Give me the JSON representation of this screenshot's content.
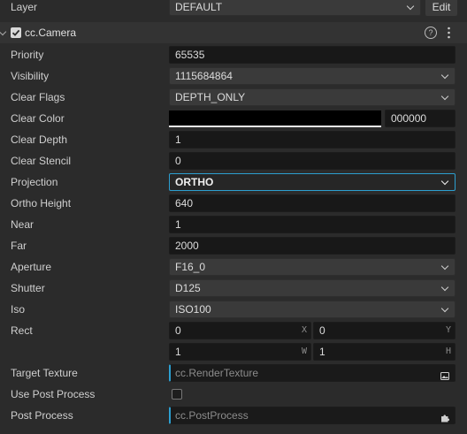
{
  "layer": {
    "label": "Layer",
    "value": "DEFAULT",
    "edit_label": "Edit"
  },
  "component": {
    "name": "cc.Camera",
    "enabled": true
  },
  "props": {
    "priority": {
      "label": "Priority",
      "value": "65535"
    },
    "visibility": {
      "label": "Visibility",
      "value": "1115684864"
    },
    "clear_flags": {
      "label": "Clear Flags",
      "value": "DEPTH_ONLY"
    },
    "clear_color": {
      "label": "Clear Color",
      "hex": "000000",
      "swatch": "#000000"
    },
    "clear_depth": {
      "label": "Clear Depth",
      "value": "1"
    },
    "clear_stencil": {
      "label": "Clear Stencil",
      "value": "0"
    },
    "projection": {
      "label": "Projection",
      "value": "ORTHO"
    },
    "ortho_height": {
      "label": "Ortho Height",
      "value": "640"
    },
    "near": {
      "label": "Near",
      "value": "1"
    },
    "far": {
      "label": "Far",
      "value": "2000"
    },
    "aperture": {
      "label": "Aperture",
      "value": "F16_0"
    },
    "shutter": {
      "label": "Shutter",
      "value": "D125"
    },
    "iso": {
      "label": "Iso",
      "value": "ISO100"
    },
    "rect": {
      "label": "Rect",
      "x": "0",
      "y": "0",
      "w": "1",
      "h": "1",
      "x_suffix": "X",
      "y_suffix": "Y",
      "w_suffix": "W",
      "h_suffix": "H"
    },
    "target_texture": {
      "label": "Target Texture",
      "placeholder": "cc.RenderTexture"
    },
    "use_post_process": {
      "label": "Use Post Process",
      "checked": false
    },
    "post_process": {
      "label": "Post Process",
      "placeholder": "cc.PostProcess"
    }
  },
  "colors": {
    "accent": "#2c9fd0",
    "background": "#2b2b2b"
  },
  "icons": {
    "help": "help-icon",
    "more": "more-icon",
    "texture": "image-icon",
    "post": "puzzle-icon"
  }
}
